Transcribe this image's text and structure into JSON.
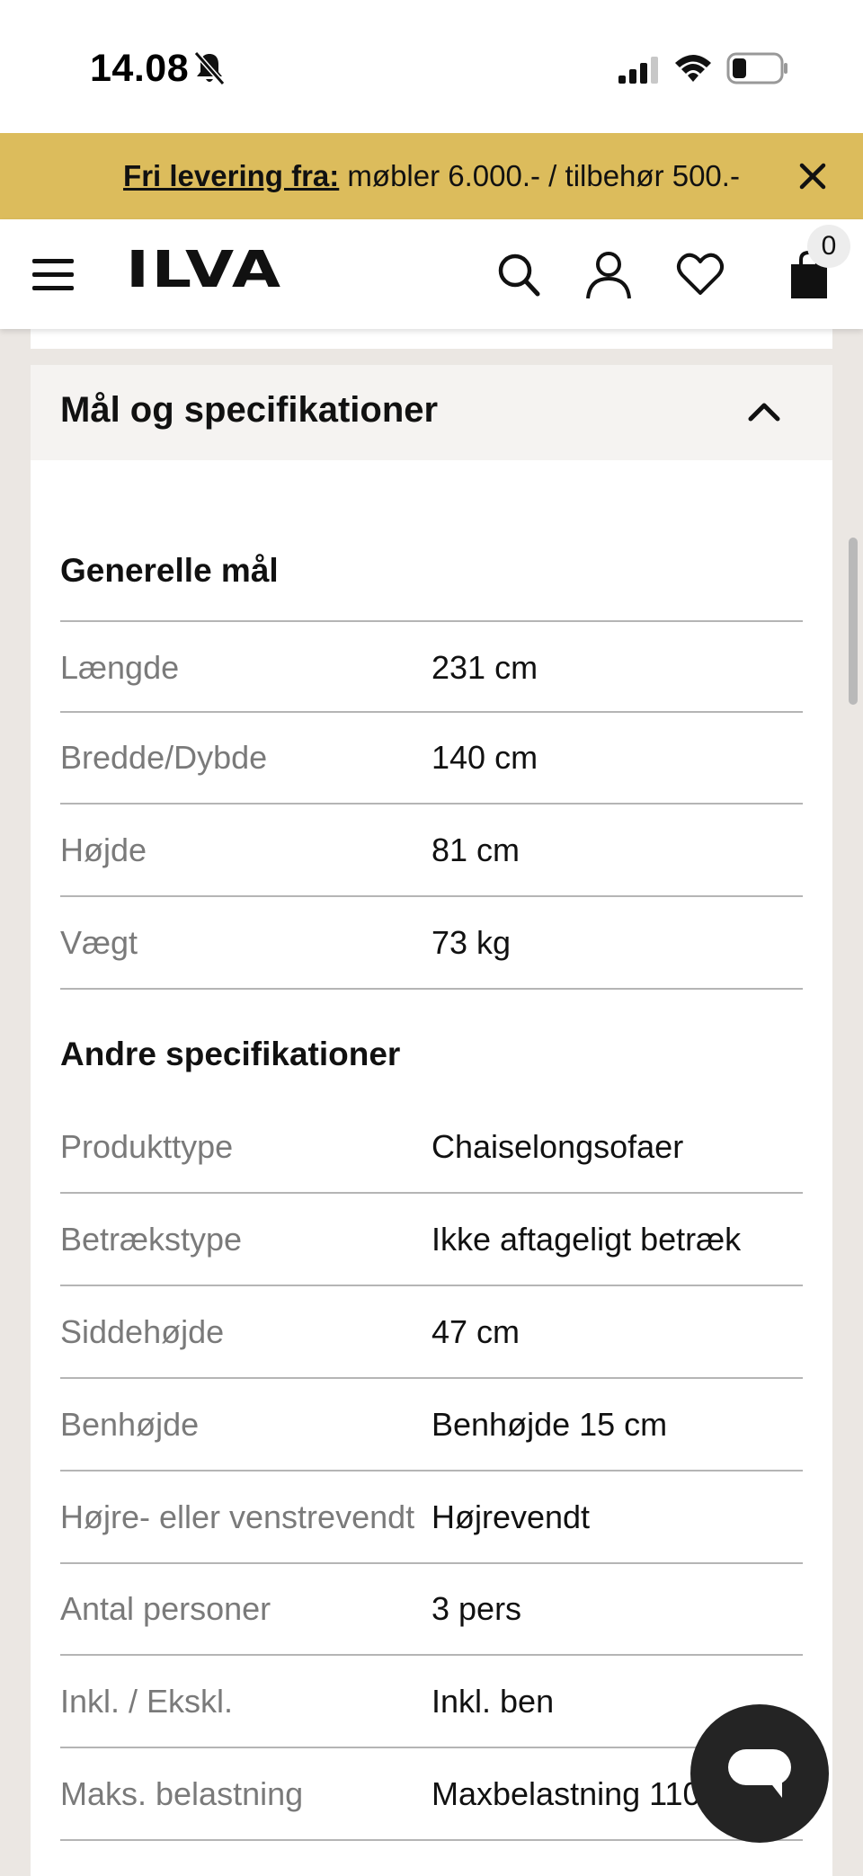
{
  "status_bar": {
    "time": "14.08"
  },
  "promo": {
    "link_text": "Fri levering fra:",
    "text": " møbler 6.000.- / tilbehør 500.-"
  },
  "header": {
    "logo": "ILVA",
    "cart_count": "0"
  },
  "specs": {
    "title": "Mål og specifikationer",
    "general": {
      "title": "Generelle mål",
      "rows": [
        {
          "label": "Længde",
          "value": "231 cm"
        },
        {
          "label": "Bredde/Dybde",
          "value": "140 cm"
        },
        {
          "label": "Højde",
          "value": "81 cm"
        },
        {
          "label": "Vægt",
          "value": "73 kg"
        }
      ]
    },
    "other": {
      "title": "Andre specifikationer",
      "rows": [
        {
          "label": "Produkttype",
          "value": "Chaiselongsofaer"
        },
        {
          "label": "Betrækstype",
          "value": "Ikke aftageligt betræk"
        },
        {
          "label": "Siddehøjde",
          "value": "47 cm"
        },
        {
          "label": "Benhøjde",
          "value": "Benhøjde 15 cm"
        },
        {
          "label": "Højre- eller venstrevendt",
          "value": "Højrevendt"
        },
        {
          "label": "Antal personer",
          "value": "3 pers"
        },
        {
          "label": "Inkl. / Ekskl.",
          "value": "Inkl. ben"
        },
        {
          "label": "Maks. belastning",
          "value": "Maxbelastning 110"
        }
      ]
    }
  }
}
